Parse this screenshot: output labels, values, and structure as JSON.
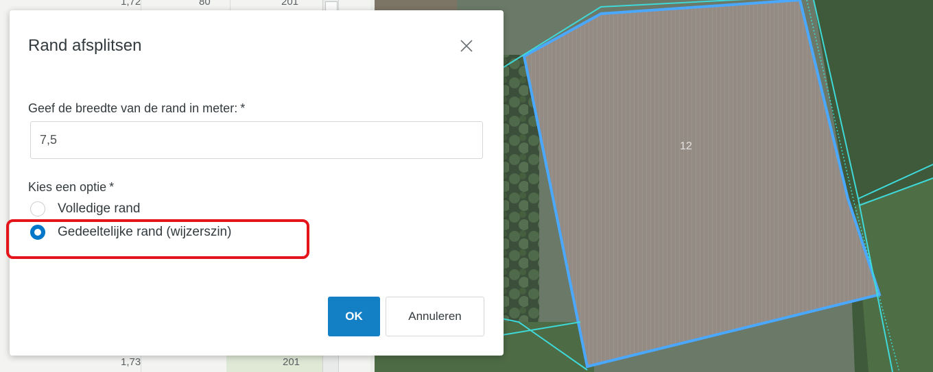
{
  "background_table": {
    "top_values": [
      "1,72",
      "80",
      "201"
    ],
    "bottom_values": [
      "1,73",
      "201"
    ]
  },
  "map": {
    "parcel_label": "12"
  },
  "dialog": {
    "title": "Rand afsplitsen",
    "close_icon": "close-icon",
    "width_label": "Geef de breedte van de rand in meter:",
    "required_marker": "*",
    "width_value": "7,5",
    "option_label": "Kies een optie",
    "options": [
      {
        "label": "Volledige rand",
        "checked": false
      },
      {
        "label": "Gedeeltelijke rand (wijzerszin)",
        "checked": true
      }
    ],
    "ok_label": "OK",
    "cancel_label": "Annuleren"
  },
  "colors": {
    "primary": "#1380c6",
    "highlight": "#e5141a",
    "parcel_outline": "#4aa8ff",
    "parcel_neighbor": "#3fd9d9"
  }
}
